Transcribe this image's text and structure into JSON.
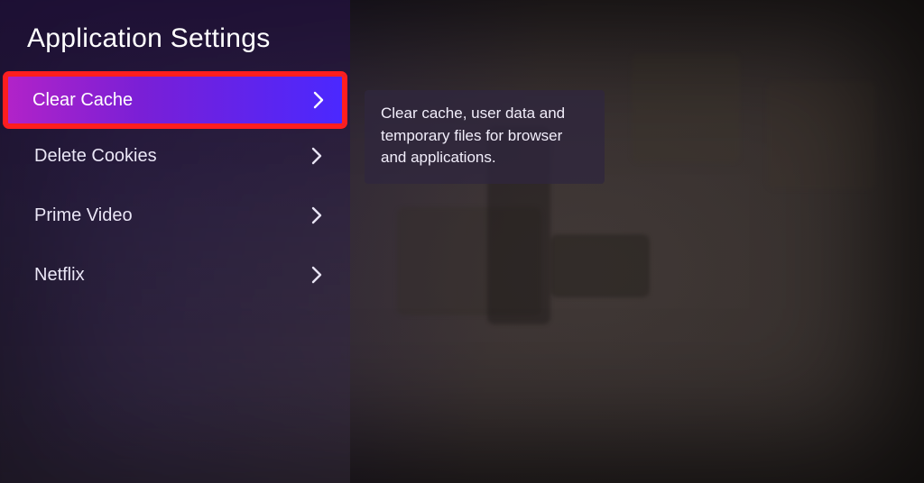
{
  "header": {
    "title": "Application Settings"
  },
  "menu": {
    "items": [
      {
        "label": "Clear Cache",
        "selected": true
      },
      {
        "label": "Delete Cookies",
        "selected": false
      },
      {
        "label": "Prime Video",
        "selected": false
      },
      {
        "label": "Netflix",
        "selected": false
      }
    ]
  },
  "description": {
    "text": "Clear cache, user data and temporary files for browser and applications."
  }
}
